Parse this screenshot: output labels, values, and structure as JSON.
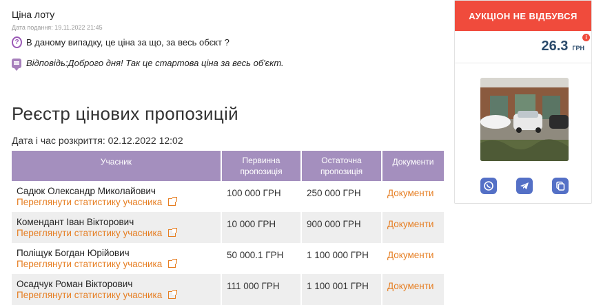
{
  "question": {
    "title": "Ціна лоту",
    "date": "Дата подання: 19.11.2022 21:45",
    "question_icon": "question-icon",
    "question_text": "В даному випадку, це ціна за що, за весь обєкт ?",
    "answer_icon": "chat-answer-icon",
    "answer_text": "Відповідь:Доброго дня! Так це стартова ціна за весь об'єкт."
  },
  "registry": {
    "title": "Реєстр цінових пропозицій",
    "open_date": "Дата і час розкриття: 02.12.2022 12:02",
    "columns": {
      "participant": "Учасник",
      "first_bid_line1": "Первинна",
      "first_bid_line2": "пропозиція",
      "last_bid_line1": "Остаточна",
      "last_bid_line2": "пропозиція",
      "documents": "Документи"
    },
    "rows": [
      {
        "name": "Садюк Олександр Миколайович",
        "stats": "Переглянути статистику учасника",
        "first": "100 000 ГРН",
        "last": "250 000 ГРН",
        "docs": "Документи"
      },
      {
        "name": "Комендант Іван Вікторович",
        "stats": "Переглянути статистику учасника",
        "first": "10 000 ГРН",
        "last": "900 000 ГРН",
        "docs": "Документи"
      },
      {
        "name": "Поліщук Богдан Юрійович",
        "stats": "Переглянути статистику учасника",
        "first": "50 000.1 ГРН",
        "last": "1 100 000 ГРН",
        "docs": "Документи"
      },
      {
        "name": "Осадчук Роман Вікторович",
        "stats": "Переглянути статистику учасника",
        "first": "111 000 ГРН",
        "last": "1 100 001 ГРН",
        "docs": "Документи"
      }
    ]
  },
  "sidebar": {
    "status": "АУКЦІОН НЕ ВІДБУВСЯ",
    "price": "26.3",
    "currency": "ГРН",
    "info_icon": "info-icon",
    "share": [
      "viber-icon",
      "telegram-icon",
      "copy-icon"
    ]
  },
  "colors": {
    "accent_orange": "#e67e22",
    "header_purple": "#a48fbe",
    "status_red": "#f04b3c",
    "price_navy": "#2a4a6b",
    "share_blue": "#5470c6"
  }
}
